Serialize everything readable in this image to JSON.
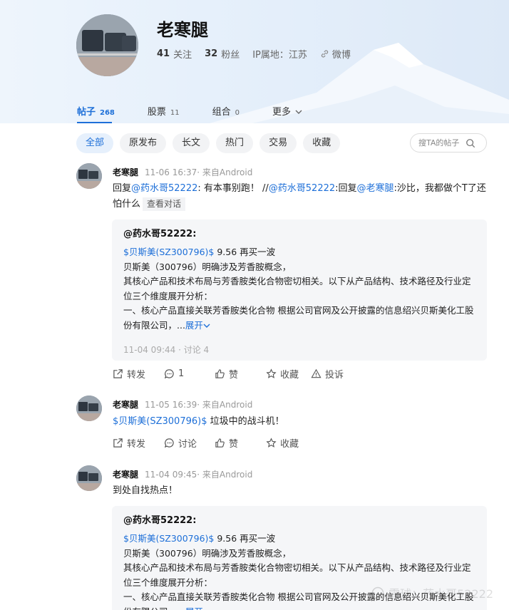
{
  "profile": {
    "name": "老寒腿",
    "following_count": "41",
    "following_label": "关注",
    "followers_count": "32",
    "followers_label": "粉丝",
    "ip_location": "IP属地：江苏",
    "weibo_label": "微博"
  },
  "tabs": [
    {
      "label": "帖子",
      "count": "268"
    },
    {
      "label": "股票",
      "count": "11"
    },
    {
      "label": "组合",
      "count": "0"
    },
    {
      "label": "更多",
      "count": ""
    }
  ],
  "filters": [
    "全部",
    "原发布",
    "长文",
    "热门",
    "交易",
    "收藏"
  ],
  "search": {
    "placeholder": "搜TA的帖子"
  },
  "posts": [
    {
      "author": "老寒腿",
      "time": "11-06 16:37",
      "source": "· 来自Android",
      "text_parts": {
        "p1": "回复",
        "mention1": "@药水哥52222",
        "p2": ": 有本事别跑！ //",
        "mention2": "@药水哥52222",
        "p3": ":回复",
        "mention3": "@老寒腿",
        "p4": ":沙比，我都做个T了还怕什么"
      },
      "view_conversation": "查看对话",
      "quote": {
        "author": "@药水哥52222:",
        "stock_tag": "$贝斯美(SZ300796)$",
        "line1_rest": " 9.56 再买一波",
        "line2": "贝斯美（300796）明确涉及芳香胺概念，",
        "line3": "其核心产品和技术布局与芳香胺类化合物密切相关。以下从产品结构、技术路径及行业定位三个维度展开分析：",
        "line4": "一、核心产品直接关联芳香胺类化合物 根据公司官网及公开披露的信息绍兴贝斯美化工股份有限公司，...",
        "expand": "展开",
        "time": "11-04 09:44",
        "discuss": "· 讨论 4"
      },
      "actions": {
        "forward": "转发",
        "comment": "1",
        "like": "赞",
        "favorite": "收藏",
        "report": "投诉"
      }
    },
    {
      "author": "老寒腿",
      "time": "11-05 16:39",
      "source": "· 来自Android",
      "stock_tag": "$贝斯美(SZ300796)$",
      "text": " 垃圾中的战斗机！",
      "actions": {
        "forward": "转发",
        "comment": "讨论",
        "like": "赞",
        "favorite": "收藏"
      }
    },
    {
      "author": "老寒腿",
      "time": "11-04 09:45",
      "source": "· 来自Android",
      "text": "到处自找热点！",
      "quote": {
        "author": "@药水哥52222:",
        "stock_tag": "$贝斯美(SZ300796)$",
        "line1_rest": " 9.56 再买一波",
        "line2": "贝斯美（300796）明确涉及芳香胺概念，",
        "line3": "其核心产品和技术布局与芳香胺类化合物密切相关。以下从产品结构、技术路径及行业定位三个维度展开分析：",
        "line4": "一、核心产品直接关联芳香胺类化合物 根据公司官网及公开披露的信息绍兴贝斯美化工股份有限公司，...",
        "expand": "展开"
      }
    }
  ],
  "watermark": "雪球：药水哥52222"
}
